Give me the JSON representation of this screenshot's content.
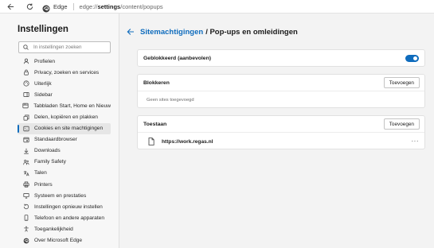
{
  "browser": {
    "name": "Edge",
    "url_prefix": "edge://",
    "url_bold": "settings",
    "url_rest": "/content/popups"
  },
  "sidebar": {
    "title": "Instellingen",
    "search_placeholder": "In instellingen zoeken",
    "items": [
      {
        "label": "Profielen",
        "icon": "profile-icon"
      },
      {
        "label": "Privacy, zoeken en services",
        "icon": "lock-icon"
      },
      {
        "label": "Uiterlijk",
        "icon": "appearance-icon"
      },
      {
        "label": "Sidebar",
        "icon": "sidebar-icon"
      },
      {
        "label": "Tabbladen Start, Home en Nieuw",
        "icon": "tabs-icon"
      },
      {
        "label": "Delen, kopiëren en plakken",
        "icon": "share-icon"
      },
      {
        "label": "Cookies en site machtigingen",
        "icon": "cookie-icon",
        "active": true
      },
      {
        "label": "Standaardbrowser",
        "icon": "browser-icon"
      },
      {
        "label": "Downloads",
        "icon": "download-icon"
      },
      {
        "label": "Family Safety",
        "icon": "family-icon"
      },
      {
        "label": "Talen",
        "icon": "language-icon"
      },
      {
        "label": "Printers",
        "icon": "printer-icon"
      },
      {
        "label": "Systeem en prestaties",
        "icon": "system-icon"
      },
      {
        "label": "Instellingen opnieuw instellen",
        "icon": "reset-icon"
      },
      {
        "label": "Telefoon en andere apparaten",
        "icon": "phone-icon"
      },
      {
        "label": "Toegankelijkheid",
        "icon": "accessibility-icon"
      },
      {
        "label": "Over Microsoft Edge",
        "icon": "edge-icon"
      }
    ]
  },
  "main": {
    "breadcrumb_link": "Sitemachtigingen",
    "breadcrumb_rest": "/ Pop-ups en omleidingen",
    "blocked_toggle_label": "Geblokkeerd (aanbevolen)",
    "blocked_toggle_on": true,
    "block_section": {
      "title": "Blokkeren",
      "add_label": "Toevoegen",
      "empty_text": "Geen sites toegevoegd"
    },
    "allow_section": {
      "title": "Toestaan",
      "add_label": "Toevoegen",
      "sites": [
        "https://work.regas.nl"
      ]
    }
  },
  "colors": {
    "accent": "#0f6cbd",
    "sidebar_bg": "#f7f7f7",
    "page_bg": "#f3f3f3"
  }
}
